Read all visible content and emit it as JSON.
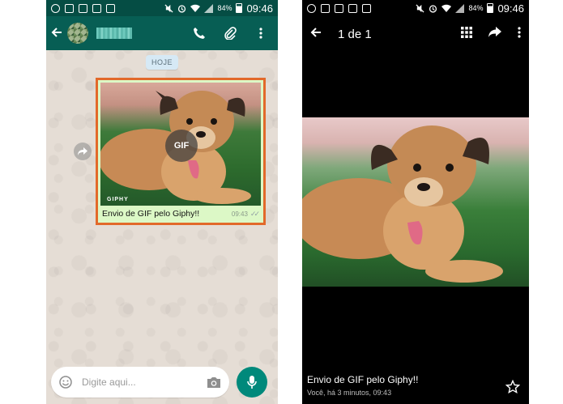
{
  "left_screen": {
    "status_bar": {
      "battery": "84%",
      "time": "09:46"
    },
    "chat": {
      "date_chip": "HOJE",
      "message": {
        "gif_badge": "GIF",
        "watermark": "GIPHY",
        "text": "Envio de GIF pelo Giphy!!",
        "time": "09:43"
      }
    },
    "composer": {
      "placeholder": "Digite aqui..."
    },
    "colors": {
      "header": "#075e54",
      "bubble": "#dcf8c6",
      "highlight": "#e2692a",
      "fab": "#00897b"
    }
  },
  "right_screen": {
    "status_bar": {
      "battery": "84%",
      "time": "09:46"
    },
    "toolbar": {
      "counter": "1 de 1"
    },
    "caption": "Envio de GIF pelo Giphy!!",
    "subcaption": "Você, há 3 minutos, 09:43"
  },
  "icons": [
    "messenger-icon",
    "gallery-icon",
    "instagram-icon",
    "voicemail-icon",
    "flipboard-icon",
    "mute-icon",
    "alarm-icon",
    "wifi-icon",
    "signal-icon",
    "battery-icon",
    "back-arrow-icon",
    "phone-icon",
    "attach-icon",
    "more-icon",
    "forward-icon",
    "emoji-icon",
    "camera-icon",
    "mic-icon",
    "grid-icon",
    "share-icon",
    "star-icon"
  ]
}
